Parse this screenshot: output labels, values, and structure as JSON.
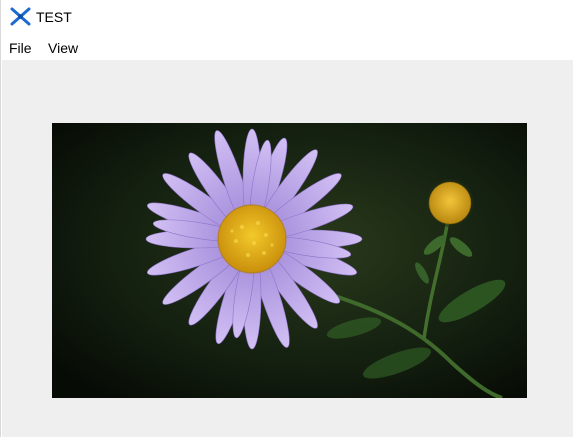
{
  "window": {
    "title": "TEST",
    "app_icon": "app-logo-icon"
  },
  "menubar": {
    "items": [
      {
        "label": "File"
      },
      {
        "label": "View"
      }
    ]
  },
  "content": {
    "image": {
      "subject": "purple-daisy-flower-photo",
      "colors": {
        "petals": "#b59ae4",
        "center": "#e6b21a",
        "background": "#10180d",
        "stem": "#3f6a2b",
        "content_bg": "#efefef"
      }
    }
  }
}
